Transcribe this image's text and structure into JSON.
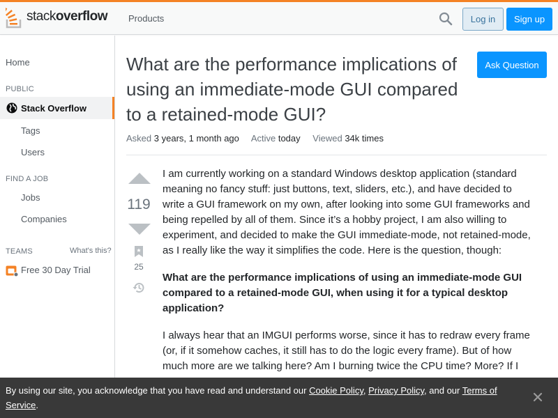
{
  "header": {
    "logo_text_light": "stack",
    "logo_text_bold": "overflow",
    "products": "Products",
    "login": "Log in",
    "signup": "Sign up"
  },
  "sidebar": {
    "home": "Home",
    "public": "PUBLIC",
    "stack_overflow": "Stack Overflow",
    "tags": "Tags",
    "users": "Users",
    "find_a_job": "FIND A JOB",
    "jobs": "Jobs",
    "companies": "Companies",
    "teams": "TEAMS",
    "whats_this": "What's this?",
    "free_trial": "Free 30 Day Trial"
  },
  "question": {
    "title": "What are the performance implications of using an immediate-mode GUI compared to a retained-mode GUI?",
    "ask_button": "Ask Question",
    "asked_label": "Asked",
    "asked_value": "3 years, 1 month ago",
    "active_label": "Active",
    "active_value": "today",
    "viewed_label": "Viewed",
    "viewed_value": "34k times",
    "votes": "119",
    "bookmarks": "25",
    "body": [
      "I am currently working on a standard Windows desktop application (standard meaning no fancy stuff: just buttons, text, sliders, etc.), and have decided to write a GUI framework on my own, after looking into some GUI frameworks and being repelled by all of them. Since it’s a hobby project, I am also willing to experiment, and decided to make the GUI immediate-mode, not retained-mode, as I really like the way it simplifies the code. Here is the question, though:",
      "What are the performance implications of using an immediate-mode GUI compared to a retained-mode GUI, when using it for a typical desktop application?",
      "I always hear that an IMGUI performs worse, since it has to redraw every frame (or, if it somehow caches, it still has to do the logic every frame). But of how much more are we talking here? Am I burning twice the CPU time? More? If I"
    ]
  },
  "cookie": {
    "prefix": "By using our site, you acknowledge that you have read and understand our ",
    "cookie_policy": "Cookie Policy",
    "sep1": ", ",
    "privacy_policy": "Privacy Policy",
    "sep2": ", and our ",
    "terms": "Terms of Service",
    "suffix": "."
  },
  "colors": {
    "accent": "#f48225",
    "primary_button": "#0a95ff",
    "cookie_bg": "#393939"
  },
  "icons": [
    "search-icon",
    "globe-icon",
    "teams-icon",
    "vote-up-icon",
    "vote-down-icon",
    "bookmark-icon",
    "history-icon",
    "close-icon"
  ]
}
